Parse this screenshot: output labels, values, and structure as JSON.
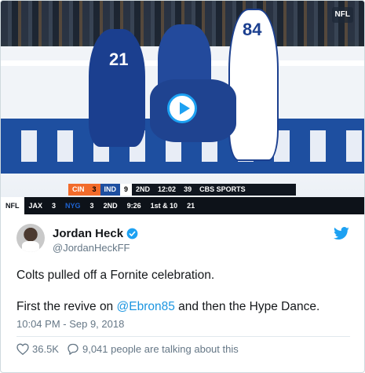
{
  "media": {
    "network_badge": "NFL",
    "scorebug": {
      "team1": "CIN",
      "score1": "3",
      "team2": "IND",
      "score2": "9",
      "quarter": "2ND",
      "clock": "12:02",
      "play_clock": "39",
      "network": "CBS SPORTS"
    },
    "ticker": {
      "league": "NFL",
      "away_team": "JAX",
      "away_score": "3",
      "home_team": "NYG",
      "home_score": "3",
      "period": "2ND",
      "time": "9:26",
      "down": "1st & 10",
      "extra": "21"
    },
    "jersey_left": "21",
    "jersey_right": "84"
  },
  "user": {
    "display_name": "Jordan Heck",
    "handle": "@JordanHeckFF"
  },
  "tweet": {
    "line1": "Colts pulled off a Fornite celebration.",
    "line2_before": "First the revive on ",
    "mention": "@Ebron85",
    "line2_after": " and then the Hype Dance.",
    "timestamp": "10:04 PM - Sep 9, 2018"
  },
  "actions": {
    "likes": "36.5K",
    "replies_text": "9,041 people are talking about this"
  },
  "colors": {
    "twitter_blue": "#1da1f2",
    "link_blue": "#1b95e0",
    "text_gray": "#657786"
  },
  "icons": {
    "play": "play-icon",
    "verified": "verified-badge-icon",
    "brand": "twitter-bird-icon",
    "like": "heart-icon",
    "reply": "speech-bubble-icon"
  }
}
